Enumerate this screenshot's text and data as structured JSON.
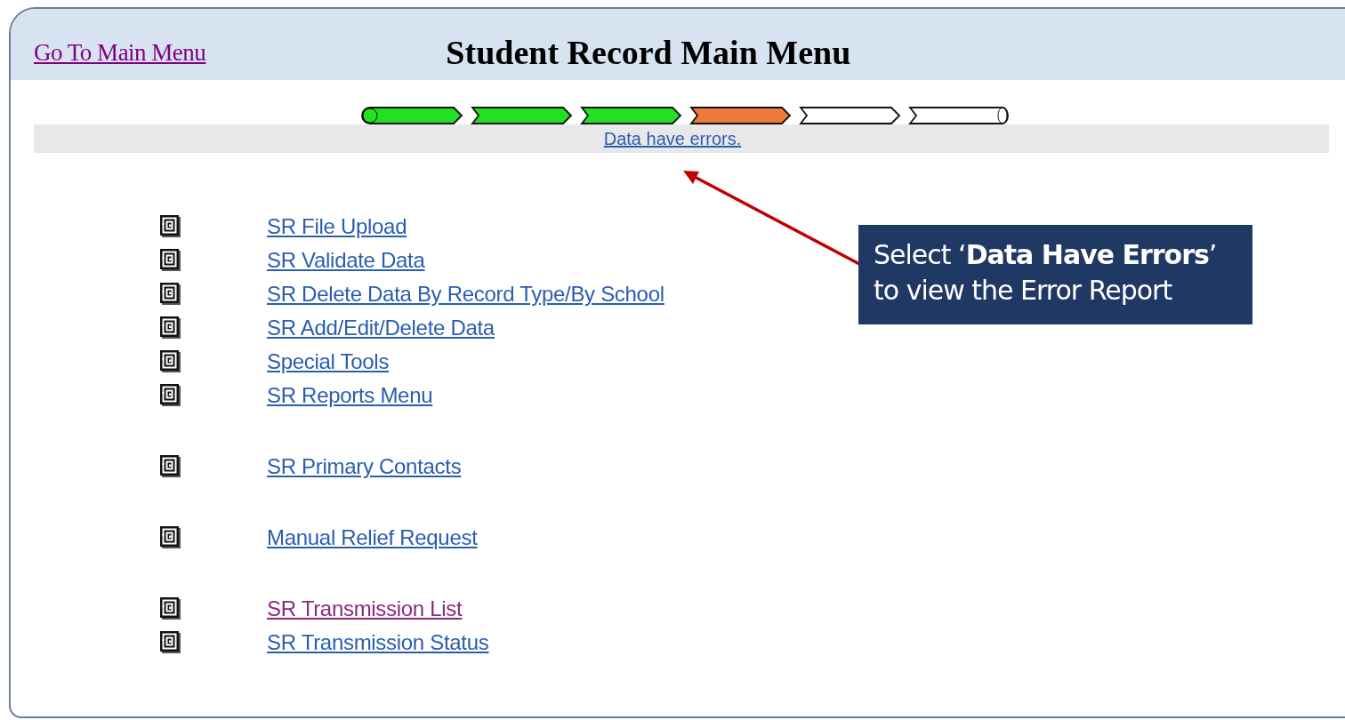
{
  "header": {
    "main_menu_link": {
      "label": "Go To Main Menu",
      "visited": true
    },
    "title": "Student Record Main Menu"
  },
  "progress": [
    {
      "kind": "done"
    },
    {
      "kind": "done"
    },
    {
      "kind": "done"
    },
    {
      "kind": "current"
    },
    {
      "kind": "pending"
    },
    {
      "kind": "pending"
    }
  ],
  "status_link": "Data have errors.",
  "menu_groups": [
    {
      "items": [
        {
          "label": "SR File Upload",
          "visited": false
        },
        {
          "label": "SR Validate Data",
          "visited": false
        },
        {
          "label": "SR Delete Data By Record Type/By School",
          "visited": false
        },
        {
          "label": "SR Add/Edit/Delete Data",
          "visited": false
        },
        {
          "label": "Special Tools",
          "visited": false
        },
        {
          "label": "SR Reports Menu",
          "visited": false
        }
      ]
    },
    {
      "items": [
        {
          "label": "SR Primary Contacts",
          "visited": false
        }
      ]
    },
    {
      "items": [
        {
          "label": "Manual Relief Request",
          "visited": false
        }
      ]
    },
    {
      "items": [
        {
          "label": "SR Transmission List",
          "visited": true
        },
        {
          "label": "SR Transmission Status",
          "visited": false
        }
      ]
    }
  ],
  "callout": {
    "line_1": "Select ‘**Data Have Errors**’",
    "line_2": "to view the Error Report"
  }
}
